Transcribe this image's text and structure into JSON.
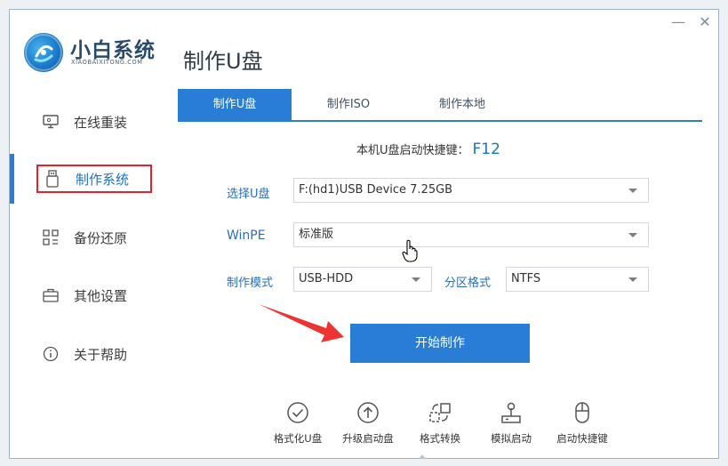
{
  "window": {
    "minimize_symbol": "—",
    "close_symbol": "✕"
  },
  "logo": {
    "title": "小白系统",
    "subtitle": "XIAOBAIXITONG.COM"
  },
  "sidebar": {
    "items": [
      {
        "label": "在线重装",
        "icon": "monitor-icon"
      },
      {
        "label": "制作系统",
        "icon": "usb-icon",
        "active": true
      },
      {
        "label": "备份还原",
        "icon": "grid-icon"
      },
      {
        "label": "其他设置",
        "icon": "briefcase-icon"
      },
      {
        "label": "关于帮助",
        "icon": "info-icon"
      }
    ]
  },
  "page": {
    "title": "制作U盘"
  },
  "tabs": [
    {
      "label": "制作U盘",
      "active": true
    },
    {
      "label": "制作ISO"
    },
    {
      "label": "制作本地"
    }
  ],
  "hotkey": {
    "label": "本机U盘启动快捷键：",
    "key": "F12"
  },
  "form": {
    "usb_label": "选择U盘",
    "usb_value": "F:(hd1)USB Device 7.25GB",
    "winpe_label": "WinPE",
    "winpe_value": "标准版",
    "mode_label": "制作模式",
    "mode_value": "USB-HDD",
    "partition_label": "分区格式",
    "partition_value": "NTFS"
  },
  "start_button": {
    "label": "开始制作"
  },
  "tools": [
    {
      "label": "格式化U盘",
      "icon": "check-circle-icon"
    },
    {
      "label": "升级启动盘",
      "icon": "upgrade-icon"
    },
    {
      "label": "格式转换",
      "icon": "convert-icon"
    },
    {
      "label": "模拟启动",
      "icon": "joystick-icon"
    },
    {
      "label": "启动快捷键",
      "icon": "mouse-icon"
    }
  ],
  "colors": {
    "accent": "#2a7dd4",
    "highlight_border": "#e2222f",
    "arrow": "#ee3333"
  }
}
